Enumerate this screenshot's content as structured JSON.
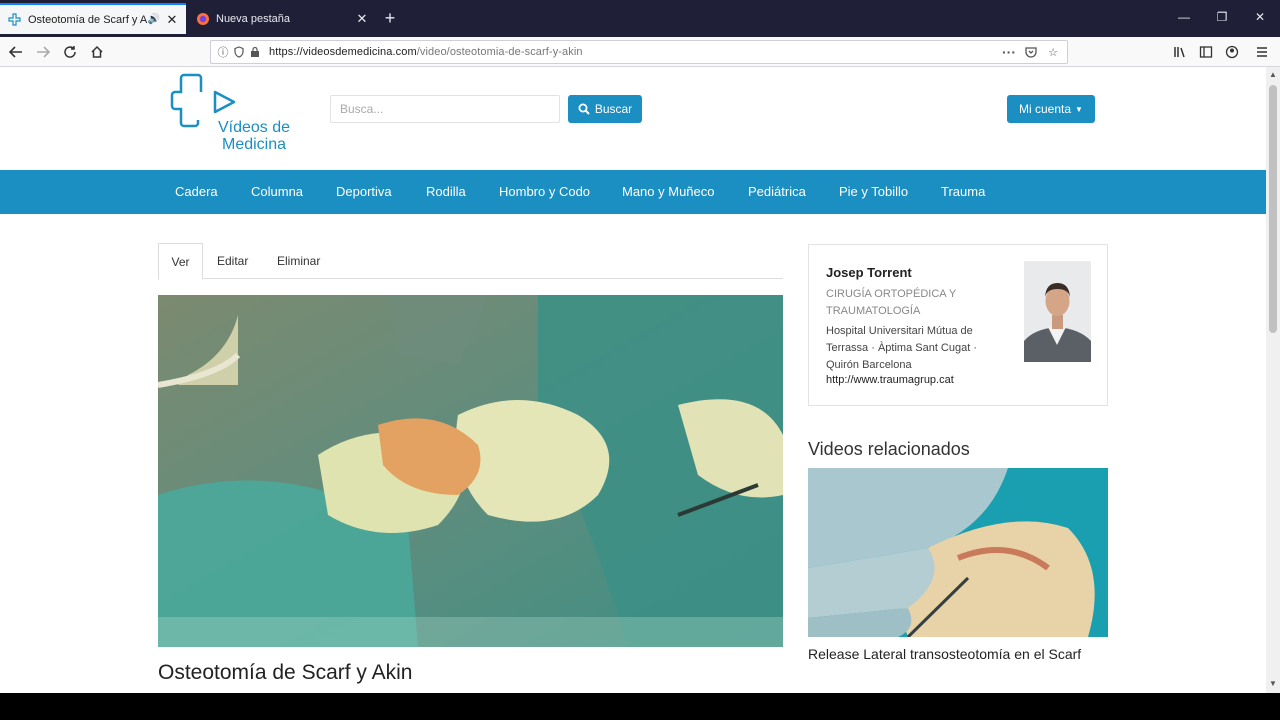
{
  "browser": {
    "tabs": [
      {
        "title": "Osteotomía de Scarf y Akin",
        "active": true
      },
      {
        "title": "Nueva pestaña",
        "active": false
      }
    ],
    "url_domain": "https://videosdemedicina.com",
    "url_path": "/video/osteotomia-de-scarf-y-akin"
  },
  "site": {
    "logo_line1": "Vídeos de",
    "logo_line2": "Medicina",
    "search_placeholder": "Busca...",
    "search_button": "Buscar",
    "account_button": "Mi cuenta"
  },
  "nav": [
    "Cadera",
    "Columna",
    "Deportiva",
    "Rodilla",
    "Hombro y Codo",
    "Mano y Muñeco",
    "Pediátrica",
    "Pie y Tobillo",
    "Trauma"
  ],
  "content_tabs": [
    "Ver",
    "Editar",
    "Eliminar"
  ],
  "video": {
    "title": "Osteotomía de Scarf y Akin"
  },
  "author": {
    "name": "Josep Torrent",
    "specialty": "CIRUGÍA ORTOPÉDICA Y TRAUMATOLOGÍA",
    "hospitals": "Hospital Universitari Mútua de Terrassa · Àptima Sant Cugat · Quirón Barcelona",
    "link": "http://www.traumagrup.cat"
  },
  "related": {
    "heading": "Videos relacionados",
    "items": [
      {
        "title": "Release Lateral transosteotomía en el Scarf"
      }
    ]
  },
  "colors": {
    "brand": "#1b8ec2",
    "tabbar": "#1f2038"
  }
}
